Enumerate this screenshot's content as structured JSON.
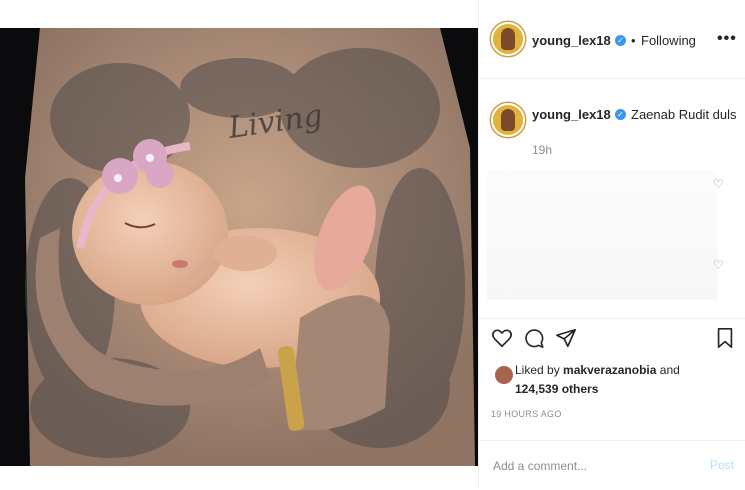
{
  "header": {
    "username": "young_lex18",
    "separator": "•",
    "follow_status": "Following",
    "more": "•••"
  },
  "caption": {
    "username": "young_lex18",
    "text": "Zaenab Rudit duls",
    "time": "19h"
  },
  "likes": {
    "prefix": "Liked by",
    "liker": "makverazanobia",
    "joiner": "and",
    "count": "124,539 others"
  },
  "post_time": "19 HOURS AGO",
  "comment": {
    "placeholder": "Add a comment...",
    "post_label": "Post"
  },
  "icons": {
    "like": "heart-icon",
    "comment": "comment-icon",
    "share": "share-icon",
    "save": "bookmark-icon",
    "verified": "verified-badge-icon",
    "comment_like": "heart-icon"
  },
  "colors": {
    "verified": "#3897f0",
    "post_button_disabled": "#b2dffc",
    "secondary_text": "#8e8e8e"
  }
}
